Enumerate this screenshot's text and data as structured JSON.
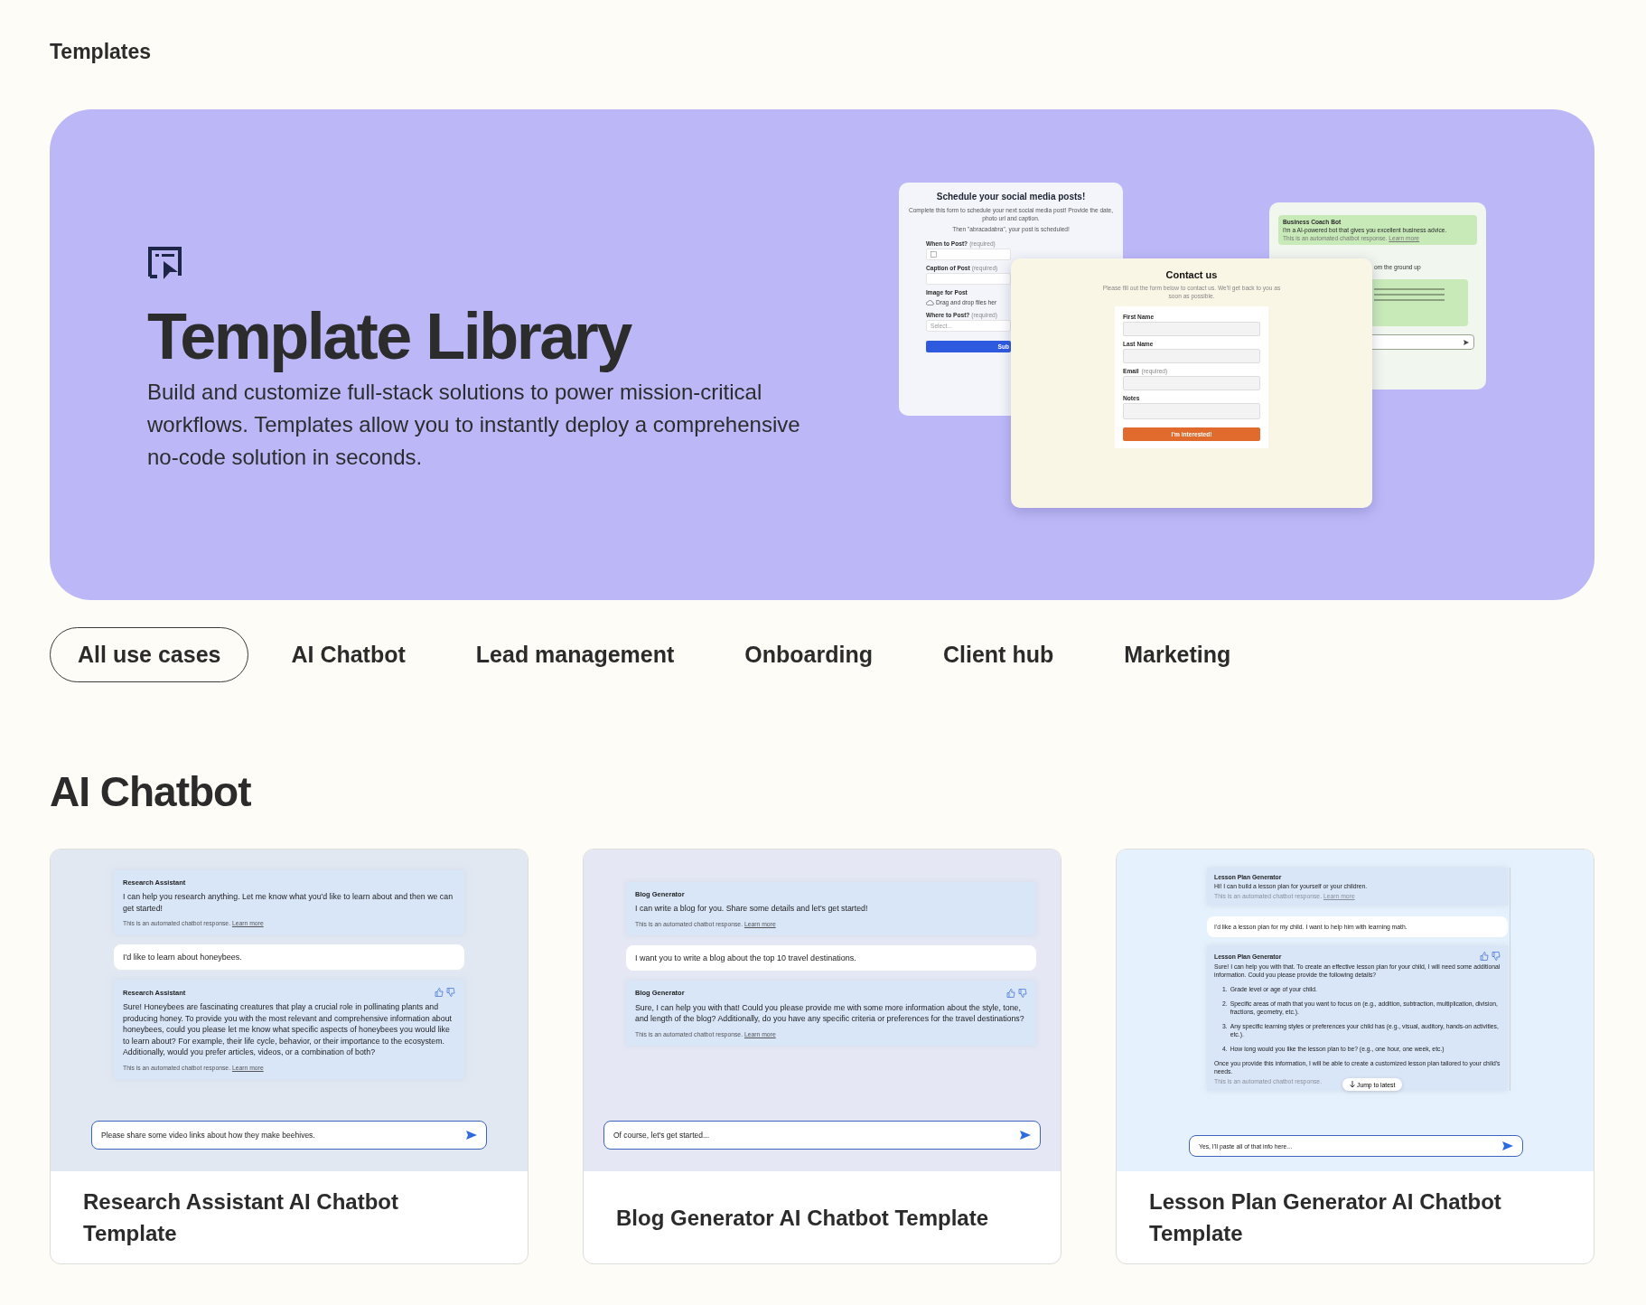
{
  "page_title": "Templates",
  "hero": {
    "title": "Template Library",
    "description": "Build and customize full-stack solutions to power mission-critical workflows. Templates allow you to instantly deploy a comprehensive no-code solution in seconds.",
    "mockups": {
      "schedule_form": {
        "title": "Schedule your social media posts!",
        "description": [
          "Complete this form to schedule your next social media post! Provide the date, photo url and caption.",
          "Then \"abracadabra\", your post is scheduled!"
        ],
        "fields": [
          {
            "kind": "date",
            "label": "When to Post?",
            "hint": "(required)"
          },
          {
            "kind": "text",
            "label": "Caption of Post",
            "hint": "(required)"
          },
          {
            "kind": "upload",
            "label": "Image for Post",
            "value": "Drag and drop files her"
          },
          {
            "kind": "select",
            "label": "Where to Post?",
            "hint": "(required)",
            "placeholder": "Select..."
          }
        ],
        "button": "Sub"
      },
      "contact_form": {
        "title": "Contact us",
        "description": "Please fill out the form below to contact us. We'll get back to you as soon as possible.",
        "fields": [
          {
            "kind": "text",
            "label": "First Name"
          },
          {
            "kind": "text",
            "label": "Last Name"
          },
          {
            "kind": "text",
            "label": "Email",
            "hint": "(required)"
          },
          {
            "kind": "textarea",
            "label": "Notes"
          }
        ],
        "button": "I'm interested!"
      },
      "chat": {
        "message": {
          "sender": "Business Coach Bot",
          "text": "I'm a AI-powered bot that gives you excellent business advice.",
          "footer": "This is an automated chatbot response.",
          "link": "Learn more"
        },
        "fragment": "om the ground up"
      }
    }
  },
  "tabs": [
    {
      "label": "All use cases",
      "selected": true
    },
    {
      "label": "AI Chatbot",
      "selected": false
    },
    {
      "label": "Lead management",
      "selected": false
    },
    {
      "label": "Onboarding",
      "selected": false
    },
    {
      "label": "Client hub",
      "selected": false
    },
    {
      "label": "Marketing",
      "selected": false
    }
  ],
  "section": {
    "title": "AI Chatbot",
    "cards": [
      {
        "title": "Research Assistant AI Chatbot Template",
        "messages": [
          {
            "kind": "bot",
            "sender": "Research Assistant",
            "text": "I can help you research anything. Let me know what you'd like to learn about and then we can get started!",
            "footer": "This is an automated chatbot response.",
            "link": "Learn more",
            "feedback": false
          },
          {
            "kind": "user",
            "text": "I'd like to learn about honeybees."
          },
          {
            "kind": "bot",
            "sender": "Research Assistant",
            "text": "Sure! Honeybees are fascinating creatures that play a crucial role in pollinating plants and producing honey. To provide you with the most relevant and comprehensive information about honeybees, could you please let me know what specific aspects of honeybees you would like to learn about? For example, their life cycle, behavior, or their importance to the ecosystem. Additionally, would you prefer articles, videos, or a combination of both?",
            "footer": "This is an automated chatbot response.",
            "link": "Learn more",
            "feedback": true
          }
        ],
        "input": "Please share some video links about how they make beehives."
      },
      {
        "title": "Blog Generator AI Chatbot Template",
        "messages": [
          {
            "kind": "bot",
            "sender": "Blog Generator",
            "text": "I can write a blog for you. Share some details and let's get started!",
            "footer": "This is an automated chatbot response.",
            "link": "Learn more",
            "feedback": false
          },
          {
            "kind": "user",
            "text": "I want you to write a blog about the top 10 travel destinations."
          },
          {
            "kind": "bot",
            "sender": "Blog Generator",
            "text": "Sure, I can help you with that! Could you please provide me with some more information about the style, tone, and length of the blog? Additionally, do you have any specific criteria or preferences for the travel destinations?",
            "footer": "This is an automated chatbot response.",
            "link": "Learn more",
            "feedback": true
          }
        ],
        "input": "Of course, let's get started..."
      },
      {
        "title": "Lesson Plan Generator AI Chatbot Template",
        "messages": [
          {
            "kind": "bot",
            "sender": "Lesson Plan Generator",
            "text": "Hi! I can build a lesson plan for yourself or your children.",
            "footer": "This is an automated chatbot response.",
            "link": "Learn more",
            "feedback": false
          },
          {
            "kind": "user",
            "text": "I'd like a lesson plan for my child. I want to help him with learning math."
          },
          {
            "kind": "bot",
            "sender": "Lesson Plan Generator",
            "text": "Sure! I can help you with that. To create an effective lesson plan for your child, I will need some additional information. Could you please provide the following details?",
            "list": [
              {
                "number": "1.",
                "text": "Grade level or age of your child."
              },
              {
                "number": "2.",
                "text": "Specific areas of math that you want to focus on (e.g., addition, subtraction, multiplication, division, fractions, geometry, etc.)."
              },
              {
                "number": "3.",
                "text": "Any specific learning styles or preferences your child has (e.g., visual, auditory, hands-on activities, etc.)."
              },
              {
                "number": "4.",
                "text": "How long would you like the lesson plan to be? (e.g., one hour, one week, etc.)"
              }
            ],
            "closing": "Once you provide this information, I will be able to create a customized lesson plan tailored to your child's needs.",
            "footer": "This is an automated chatbot response.",
            "feedback": true
          }
        ],
        "jump": "Jump to latest",
        "input": "Yes, I'll paste all of that info here..."
      }
    ]
  }
}
